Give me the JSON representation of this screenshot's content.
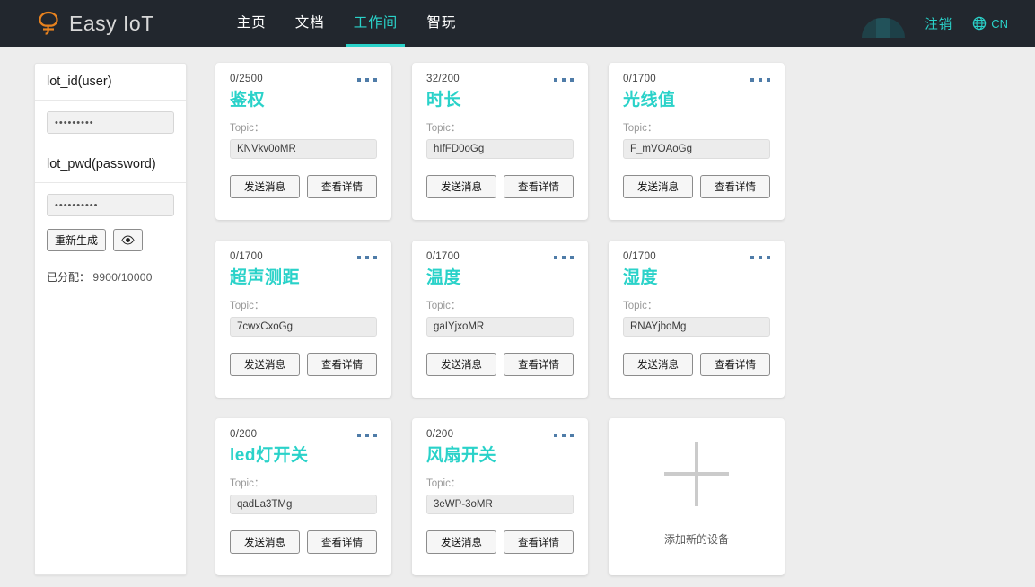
{
  "header": {
    "brand": "Easy IoT",
    "brand_icon": "tree-logo-icon",
    "nav": [
      {
        "label": "主页",
        "active": false
      },
      {
        "label": "文档",
        "active": false
      },
      {
        "label": "工作间",
        "active": true
      },
      {
        "label": "智玩",
        "active": false
      }
    ],
    "logout_label": "注销",
    "language_label": "CN",
    "language_icon": "globe-icon",
    "avatar_alt": "user-avatar",
    "accent_color": "#2ad2c9",
    "background_color": "#22272e",
    "brand_icon_color": "#e8821e"
  },
  "sidebar": {
    "id_section": {
      "title": "lot_id(user)",
      "value": "•••••••••",
      "placeholder": ""
    },
    "pwd_section": {
      "title": "lot_pwd(password)",
      "value": "••••••••••",
      "placeholder": "",
      "regenerate_label": "重新生成",
      "toggle_icon": "eye-icon"
    },
    "allocation_label": "已分配：",
    "allocation_value": "9900/10000"
  },
  "devices": {
    "topic_label": "Topic：",
    "send_label": "发送消息",
    "detail_label": "查看详情",
    "menu_icon": "more-dots-icon",
    "items": [
      {
        "count": "0/2500",
        "name": "鉴权",
        "topic": "KNVkv0oMR"
      },
      {
        "count": "32/200",
        "name": "时长",
        "topic": "hIfFD0oGg"
      },
      {
        "count": "0/1700",
        "name": "光线值",
        "topic": "F_mVOAoGg"
      },
      {
        "count": "0/1700",
        "name": "超声测距",
        "topic": "7cwxCxoGg"
      },
      {
        "count": "0/1700",
        "name": "温度",
        "topic": "gaIYjxoMR"
      },
      {
        "count": "0/1700",
        "name": "湿度",
        "topic": "RNAYjboMg"
      },
      {
        "count": "0/200",
        "name": "led灯开关",
        "topic": "qadLa3TMg"
      },
      {
        "count": "0/200",
        "name": "风扇开关",
        "topic": "3eWP-3oMR"
      }
    ]
  },
  "add_device": {
    "label": "添加新的设备",
    "icon": "plus-icon"
  }
}
